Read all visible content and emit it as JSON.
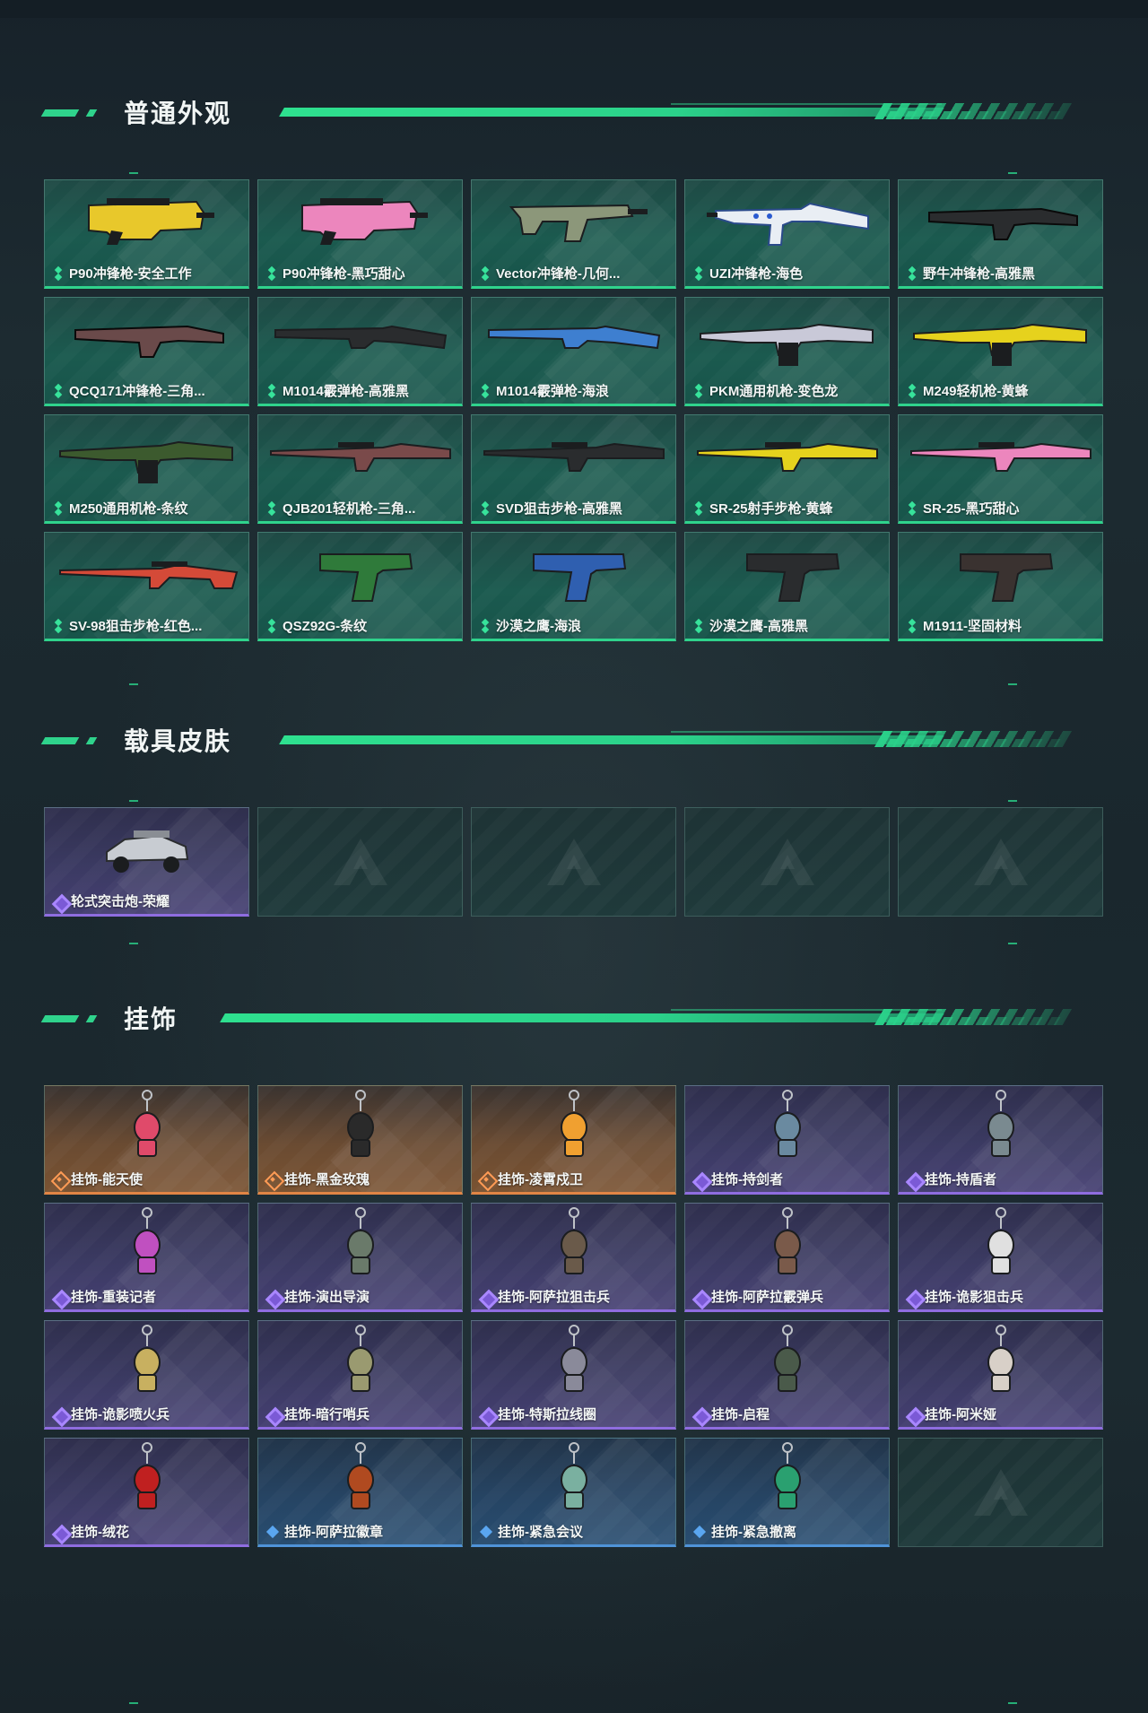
{
  "sections": {
    "weapons": {
      "title": "普通外观"
    },
    "vehicles": {
      "title": "载具皮肤"
    },
    "charms": {
      "title": "挂饰"
    }
  },
  "colors": {
    "accent": "#2fd38c",
    "green_rarity": "#37e39b",
    "purple_rarity": "#8f6de0",
    "orange_rarity": "#e28545",
    "blue_rarity": "#4f93d8"
  },
  "weapons": [
    {
      "label": "P90冲锋枪-安全工作",
      "icon": "smg-p90-yellow",
      "color": "#e8c82b",
      "shape": "p90"
    },
    {
      "label": "P90冲锋枪-黑巧甜心",
      "icon": "smg-p90-pink",
      "color": "#ec86bd",
      "shape": "p90"
    },
    {
      "label": "Vector冲锋枪-几何...",
      "icon": "smg-vector-camo",
      "color": "#8c977a",
      "shape": "vector"
    },
    {
      "label": "UZI冲锋枪-海色",
      "icon": "smg-uzi-white-blue",
      "color": "#e9eef4",
      "shape": "uzi"
    },
    {
      "label": "野牛冲锋枪-高雅黑",
      "icon": "smg-bizon-black",
      "color": "#2a2c2e",
      "shape": "smg"
    },
    {
      "label": "QCQ171冲锋枪-三角...",
      "icon": "smg-qcq171",
      "color": "#6a4a4a",
      "shape": "smg"
    },
    {
      "label": "M1014霰弹枪-高雅黑",
      "icon": "shotgun-m1014-black",
      "color": "#2a2c2e",
      "shape": "shotgun"
    },
    {
      "label": "M1014霰弹枪-海浪",
      "icon": "shotgun-m1014-blue",
      "color": "#3e7fd0",
      "shape": "shotgun"
    },
    {
      "label": "PKM通用机枪-变色龙",
      "icon": "mg-pkm-white",
      "color": "#c9c9d8",
      "shape": "mg"
    },
    {
      "label": "M249轻机枪-黄蜂",
      "icon": "lmg-m249-yellow",
      "color": "#e6d21d",
      "shape": "mg"
    },
    {
      "label": "M250通用机枪-条纹",
      "icon": "mg-m250-green",
      "color": "#3c5a2e",
      "shape": "mg"
    },
    {
      "label": "QJB201轻机枪-三角...",
      "icon": "lmg-qjb201",
      "color": "#7a4a4a",
      "shape": "rifle"
    },
    {
      "label": "SVD狙击步枪-高雅黑",
      "icon": "sniper-svd-black",
      "color": "#2a2c2e",
      "shape": "rifle"
    },
    {
      "label": "SR-25射手步枪-黄蜂",
      "icon": "rifle-sr25-yellow",
      "color": "#e6d21d",
      "shape": "rifle"
    },
    {
      "label": "SR-25-黑巧甜心",
      "icon": "rifle-sr25-pink",
      "color": "#ec86bd",
      "shape": "rifle"
    },
    {
      "label": "SV-98狙击步枪-红色...",
      "icon": "sniper-sv98-red",
      "color": "#d44a38",
      "shape": "sniper"
    },
    {
      "label": "QSZ92G-条纹",
      "icon": "pistol-qsz92g-green",
      "color": "#2f7a3a",
      "shape": "pistol"
    },
    {
      "label": "沙漠之鹰-海浪",
      "icon": "pistol-deagle-blue",
      "color": "#2f5fb0",
      "shape": "pistol"
    },
    {
      "label": "沙漠之鹰-高雅黑",
      "icon": "pistol-deagle-black",
      "color": "#2a2c2e",
      "shape": "pistol"
    },
    {
      "label": "M1911-坚固材料",
      "icon": "pistol-m1911-brown",
      "color": "#3a3230",
      "shape": "pistol"
    }
  ],
  "vehicles": [
    {
      "label": "轮式突击炮-荣耀",
      "icon": "vehicle-wheeled-assault-gun",
      "rarity": "purple"
    }
  ],
  "charms": [
    {
      "label": "挂饰-能天使",
      "icon": "charm-exusiai",
      "rarity": "orange",
      "color": "#e04a6a"
    },
    {
      "label": "挂饰-黑金玫瑰",
      "icon": "charm-black-gold-rose",
      "rarity": "orange",
      "color": "#2a2a2a"
    },
    {
      "label": "挂饰-凌霄戍卫",
      "icon": "charm-lingxiao-guard",
      "rarity": "orange",
      "color": "#f0a030"
    },
    {
      "label": "挂饰-持剑者",
      "icon": "charm-sword-bearer",
      "rarity": "purple",
      "color": "#6a8aa0"
    },
    {
      "label": "挂饰-持盾者",
      "icon": "charm-shield-bearer",
      "rarity": "purple",
      "color": "#7a8a90"
    },
    {
      "label": "挂饰-重装记者",
      "icon": "charm-heavy-reporter",
      "rarity": "purple",
      "color": "#c050c0"
    },
    {
      "label": "挂饰-演出导演",
      "icon": "charm-show-director",
      "rarity": "purple",
      "color": "#6a7a6a"
    },
    {
      "label": "挂饰-阿萨拉狙击兵",
      "icon": "charm-asala-sniper",
      "rarity": "purple",
      "color": "#6a5a4a"
    },
    {
      "label": "挂饰-阿萨拉霰弹兵",
      "icon": "charm-asala-shotgunner",
      "rarity": "purple",
      "color": "#7a5a4a"
    },
    {
      "label": "挂饰-诡影狙击兵",
      "icon": "charm-shadow-sniper",
      "rarity": "purple",
      "color": "#e0e0e0"
    },
    {
      "label": "挂饰-诡影喷火兵",
      "icon": "charm-shadow-flamethrower",
      "rarity": "purple",
      "color": "#c8b060"
    },
    {
      "label": "挂饰-暗行哨兵",
      "icon": "charm-shadow-sentry",
      "rarity": "purple",
      "color": "#9a9a70"
    },
    {
      "label": "挂饰-特斯拉线圈",
      "icon": "charm-tesla-coil",
      "rarity": "purple",
      "color": "#8a8a9a"
    },
    {
      "label": "挂饰-启程",
      "icon": "charm-departure",
      "rarity": "purple",
      "color": "#4a5a4a"
    },
    {
      "label": "挂饰-阿米娅",
      "icon": "charm-amiya",
      "rarity": "purple",
      "color": "#d8d0c8"
    },
    {
      "label": "挂饰-绒花",
      "icon": "charm-velvet-flower",
      "rarity": "purple",
      "color": "#c02020"
    },
    {
      "label": "挂饰-阿萨拉徽章",
      "icon": "charm-asala-badge",
      "rarity": "blue",
      "color": "#b04a20"
    },
    {
      "label": "挂饰-紧急会议",
      "icon": "charm-emergency-meeting",
      "rarity": "blue",
      "color": "#7ab0a0"
    },
    {
      "label": "挂饰-紧急撤离",
      "icon": "charm-emergency-evac",
      "rarity": "blue",
      "color": "#2aa070"
    }
  ]
}
